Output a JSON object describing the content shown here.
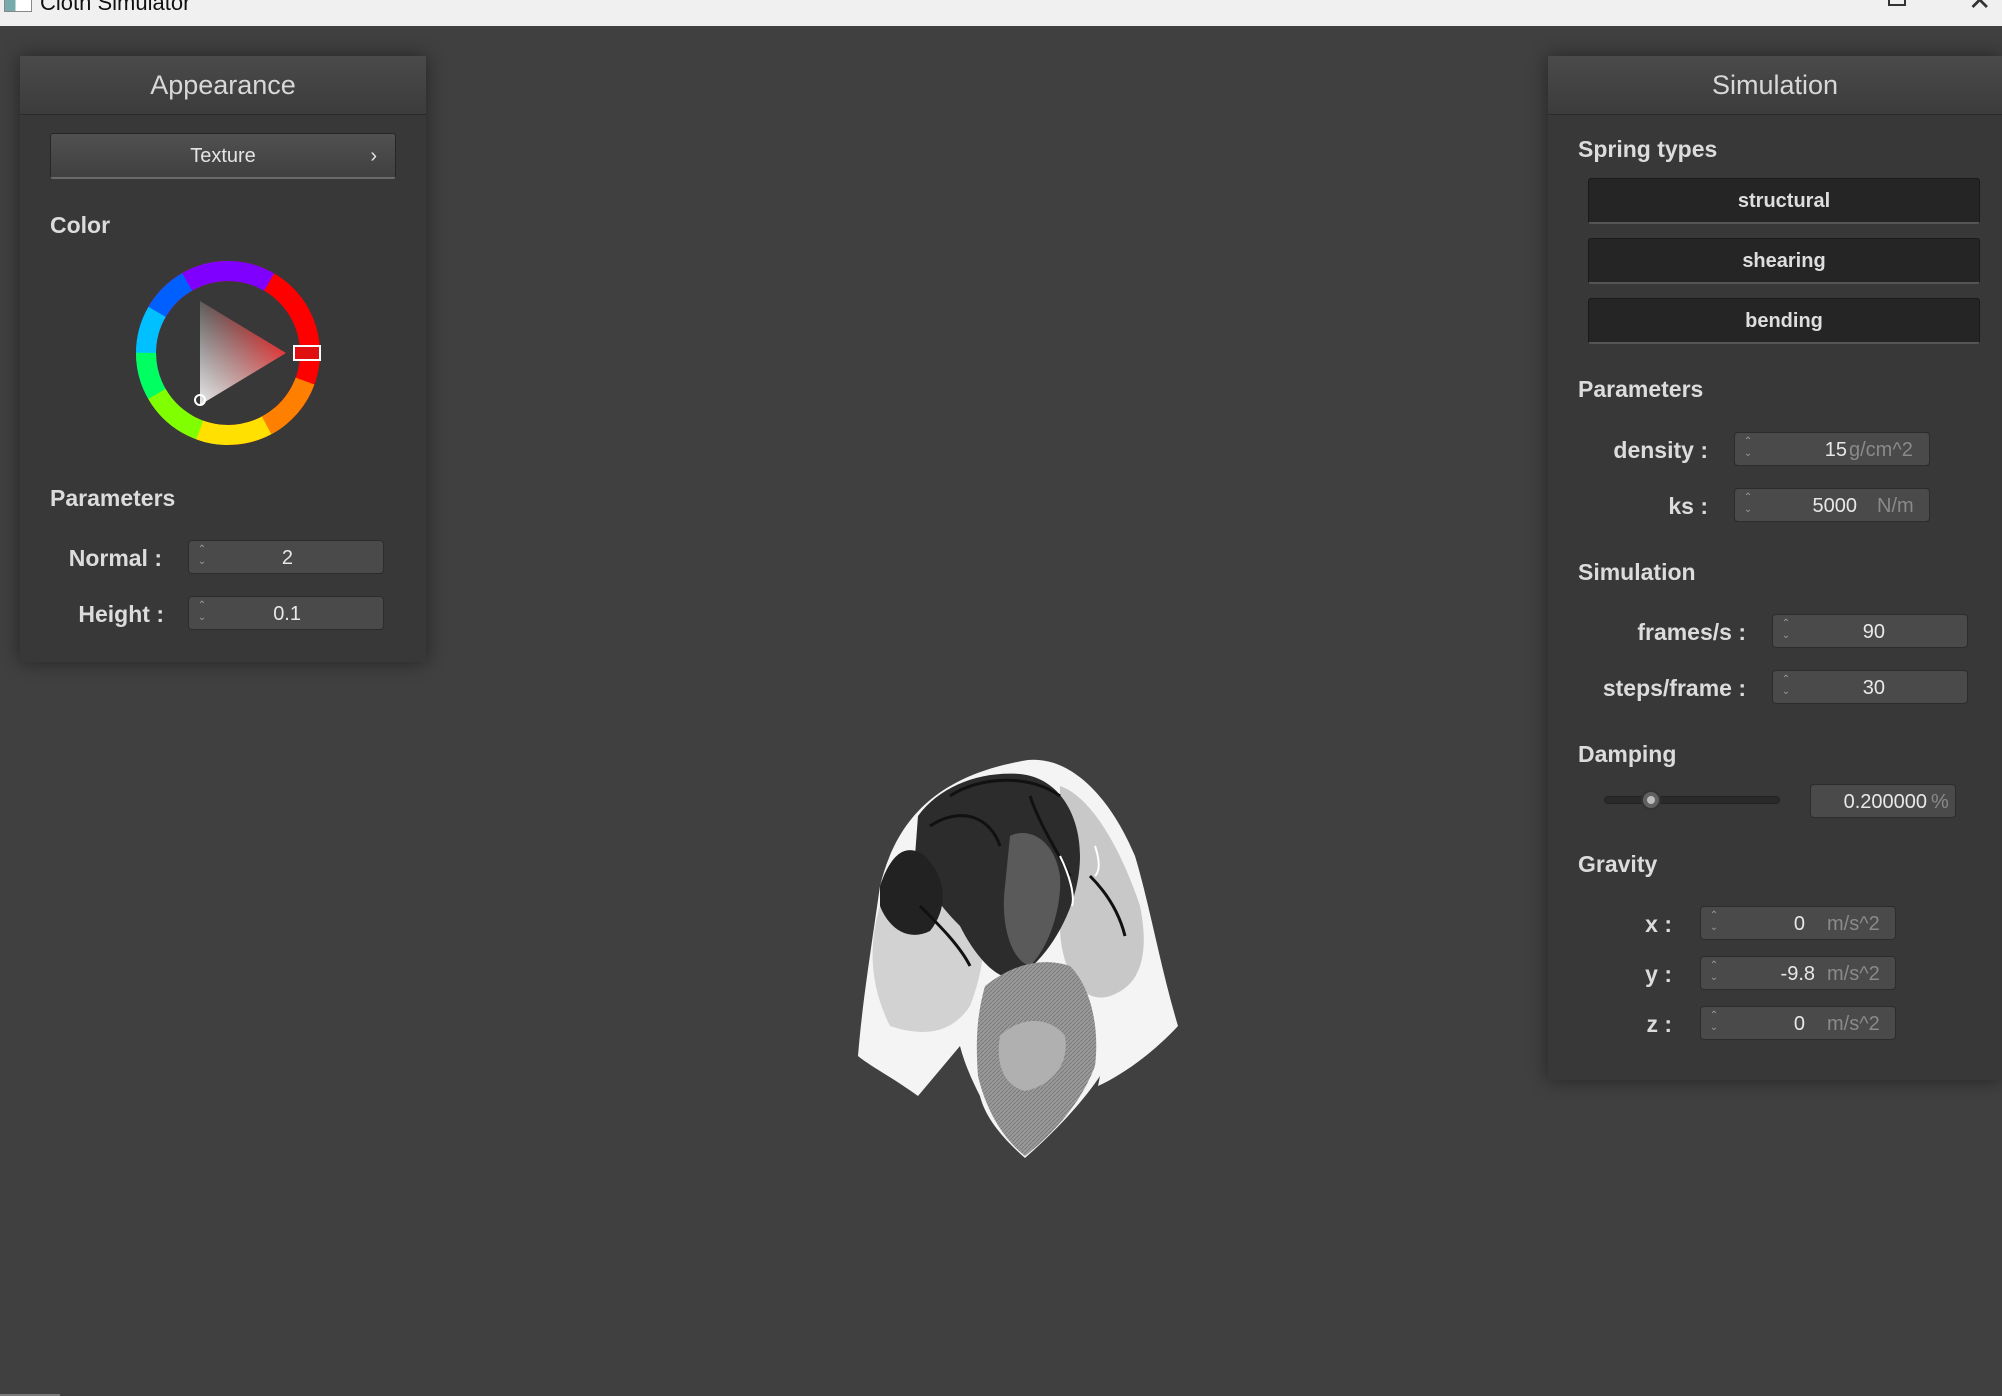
{
  "window": {
    "title": "Cloth Simulator",
    "close_glyph": "✕"
  },
  "appearance": {
    "header": "Appearance",
    "texture_button": {
      "label": "Texture",
      "chevron": "›"
    },
    "color_section": "Color",
    "selected_color": "#e01010",
    "parameters_section": "Parameters",
    "normal": {
      "label": "Normal :",
      "value": "2"
    },
    "height": {
      "label": "Height :",
      "value": "0.1"
    }
  },
  "simulation_panel": {
    "header": "Simulation",
    "spring_types_section": "Spring types",
    "spring_buttons": [
      "structural",
      "shearing",
      "bending"
    ],
    "parameters_section": "Parameters",
    "density": {
      "label": "density :",
      "value": "15",
      "unit": "g/cm^2"
    },
    "ks": {
      "label": "ks :",
      "value": "5000",
      "unit": "N/m"
    },
    "simulation_section": "Simulation",
    "frames_per_s": {
      "label": "frames/s :",
      "value": "90"
    },
    "steps_per_frame": {
      "label": "steps/frame :",
      "value": "30"
    },
    "damping_section": "Damping",
    "damping": {
      "value": "0.200000",
      "unit": "%",
      "slider_fraction": 0.2
    },
    "gravity_section": "Gravity",
    "gravity": [
      {
        "label": "x :",
        "value": "0",
        "unit": "m/s^2"
      },
      {
        "label": "y :",
        "value": "-9.8",
        "unit": "m/s^2"
      },
      {
        "label": "z :",
        "value": "0",
        "unit": "m/s^2"
      }
    ]
  },
  "icons": {
    "app": "app-window-icon",
    "maximize": "maximize-icon",
    "close": "close-icon",
    "spin_arrows": "⌃⌄"
  }
}
